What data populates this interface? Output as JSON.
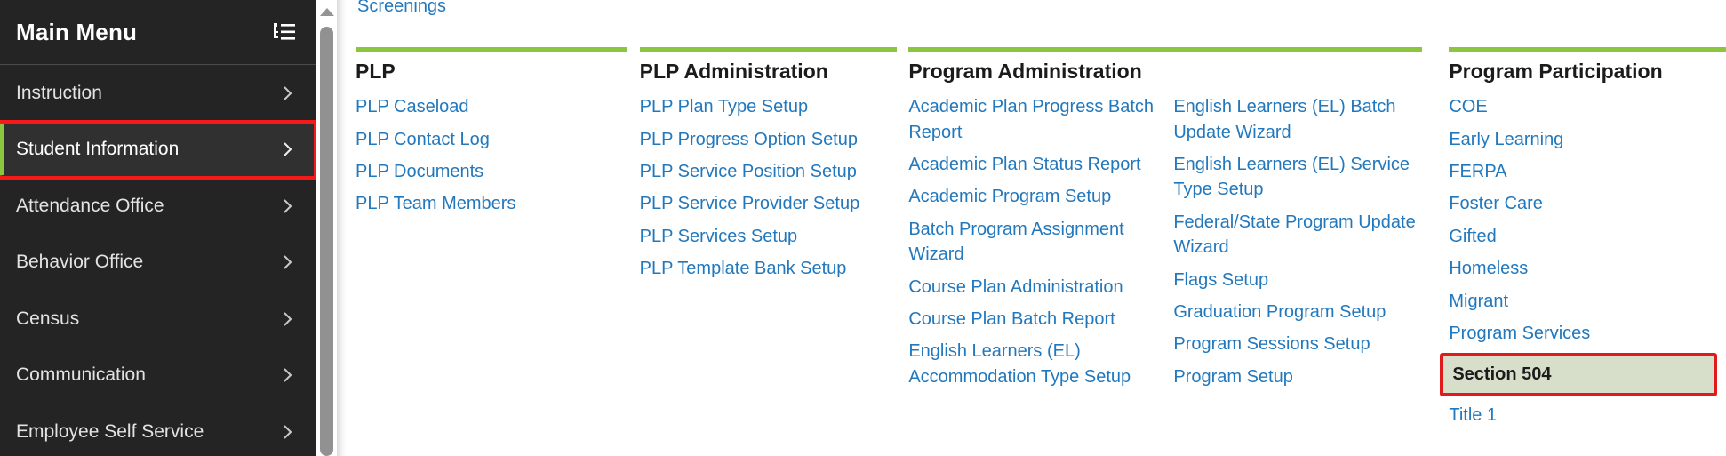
{
  "sidebar": {
    "title": "Main Menu",
    "tree_icon": "tree-list-icon",
    "items": [
      {
        "label": "Instruction",
        "selected": false
      },
      {
        "label": "Student Information",
        "selected": true
      },
      {
        "label": "Attendance Office",
        "selected": false
      },
      {
        "label": "Behavior Office",
        "selected": false
      },
      {
        "label": "Census",
        "selected": false
      },
      {
        "label": "Communication",
        "selected": false
      },
      {
        "label": "Employee Self Service",
        "selected": false
      }
    ],
    "colors": {
      "background": "#242424",
      "selected_background": "#303030",
      "selected_outline": "#f51919",
      "accent_bar": "#8cc63e",
      "text": "#e3e3e3"
    }
  },
  "scrollbar": {
    "up_arrow_icon": "scroll-up-arrow-icon",
    "thumb": "scrollbar-thumb"
  },
  "content": {
    "orphan_link": "Screenings",
    "link_color": "#2278bd",
    "rule_color": "#8cc63e",
    "highlight": {
      "background": "#d7dfcb",
      "border": "#e01b1b"
    },
    "columns": [
      {
        "heading": "PLP",
        "links": [
          {
            "label": "PLP Caseload",
            "highlighted": false
          },
          {
            "label": "PLP Contact Log",
            "highlighted": false
          },
          {
            "label": "PLP Documents",
            "highlighted": false
          },
          {
            "label": "PLP Team Members",
            "highlighted": false
          }
        ]
      },
      {
        "heading": "PLP Administration",
        "links": [
          {
            "label": "PLP Plan Type Setup",
            "highlighted": false
          },
          {
            "label": "PLP Progress Option Setup",
            "highlighted": false
          },
          {
            "label": "PLP Service Position Setup",
            "highlighted": false
          },
          {
            "label": "PLP Service Provider Setup",
            "highlighted": false
          },
          {
            "label": "PLP Services Setup",
            "highlighted": false
          },
          {
            "label": "PLP Template Bank Setup",
            "highlighted": false
          }
        ]
      },
      {
        "heading": "Program Administration",
        "links": [
          {
            "label": "Academic Plan Progress Batch Report",
            "highlighted": false
          },
          {
            "label": "Academic Plan Status Report",
            "highlighted": false
          },
          {
            "label": "Academic Program Setup",
            "highlighted": false
          },
          {
            "label": "Batch Program Assignment Wizard",
            "highlighted": false
          },
          {
            "label": "Course Plan Administration",
            "highlighted": false
          },
          {
            "label": "Course Plan Batch Report",
            "highlighted": false
          },
          {
            "label": "English Learners (EL) Accommodation Type Setup",
            "highlighted": false
          }
        ],
        "links_second": [
          {
            "label": "English Learners (EL) Batch Update Wizard",
            "highlighted": false
          },
          {
            "label": "English Learners (EL) Service Type Setup",
            "highlighted": false
          },
          {
            "label": "Federal/State Program Update Wizard",
            "highlighted": false
          },
          {
            "label": "Flags Setup",
            "highlighted": false
          },
          {
            "label": "Graduation Program Setup",
            "highlighted": false
          },
          {
            "label": "Program Sessions Setup",
            "highlighted": false
          },
          {
            "label": "Program Setup",
            "highlighted": false
          }
        ]
      },
      {
        "heading": "Program Participation",
        "links": [
          {
            "label": "COE",
            "highlighted": false
          },
          {
            "label": "Early Learning",
            "highlighted": false
          },
          {
            "label": "FERPA",
            "highlighted": false
          },
          {
            "label": "Foster Care",
            "highlighted": false
          },
          {
            "label": "Gifted",
            "highlighted": false
          },
          {
            "label": "Homeless",
            "highlighted": false
          },
          {
            "label": "Migrant",
            "highlighted": false
          },
          {
            "label": "Program Services",
            "highlighted": false
          },
          {
            "label": "Section 504",
            "highlighted": true
          },
          {
            "label": "Title 1",
            "highlighted": false
          }
        ]
      }
    ]
  }
}
